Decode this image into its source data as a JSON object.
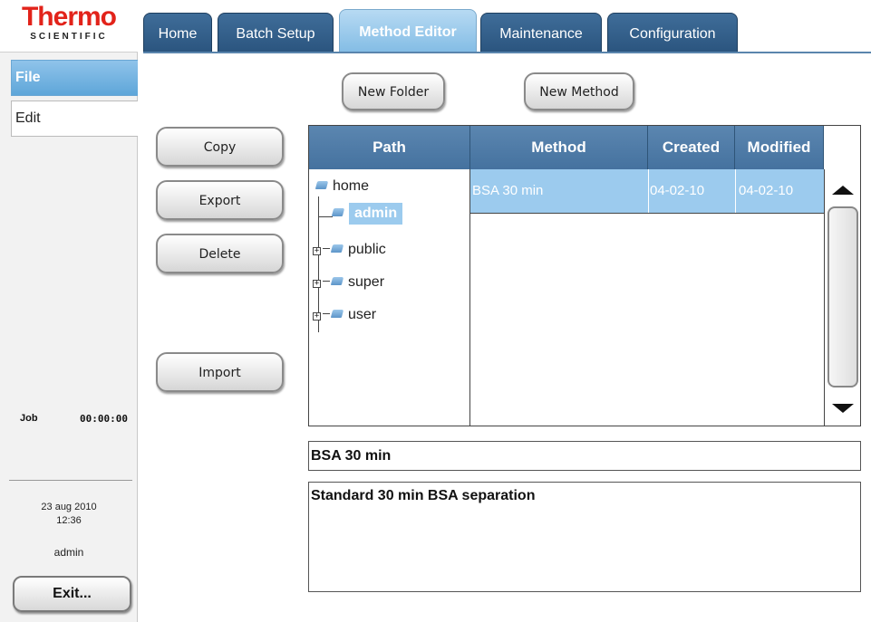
{
  "logo": {
    "brand": "Thermo",
    "sub": "SCIENTIFIC"
  },
  "side_menu": [
    {
      "label": "File",
      "selected": true
    },
    {
      "label": "Edit",
      "selected": false
    }
  ],
  "status": {
    "job_label": "Job",
    "job_time": "00:00:00",
    "date": "23 aug 2010",
    "time": "12:36",
    "user": "admin",
    "exit_label": "Exit..."
  },
  "tabs": [
    {
      "label": "Home",
      "active": false
    },
    {
      "label": "Batch Setup",
      "active": false
    },
    {
      "label": "Method Editor",
      "active": true
    },
    {
      "label": "Maintenance",
      "active": false
    },
    {
      "label": "Configuration",
      "active": false
    }
  ],
  "toolbar": {
    "new_folder": "New Folder",
    "new_method": "New Method"
  },
  "actions": {
    "copy": "Copy",
    "export": "Export",
    "delete": "Delete",
    "import": "Import"
  },
  "browser": {
    "columns": {
      "path": "Path",
      "method": "Method",
      "created": "Created",
      "modified": "Modified"
    },
    "tree": [
      {
        "label": "home",
        "expandable": false,
        "selected": false
      },
      {
        "label": "admin",
        "expandable": false,
        "selected": true
      },
      {
        "label": "public",
        "expandable": true,
        "selected": false
      },
      {
        "label": "super",
        "expandable": true,
        "selected": false
      },
      {
        "label": "user",
        "expandable": true,
        "selected": false
      }
    ],
    "methods": [
      {
        "name": "BSA 30 min",
        "created": "04-02-10",
        "modified": "04-02-10",
        "selected": true
      }
    ]
  },
  "details": {
    "name": "BSA 30 min",
    "description": "Standard 30 min BSA separation"
  },
  "colors": {
    "tab": "#2f5a85",
    "tab_active": "#9ccbee",
    "header": "#5580aa",
    "selection": "#9ccbee",
    "brand": "#e2231a"
  }
}
